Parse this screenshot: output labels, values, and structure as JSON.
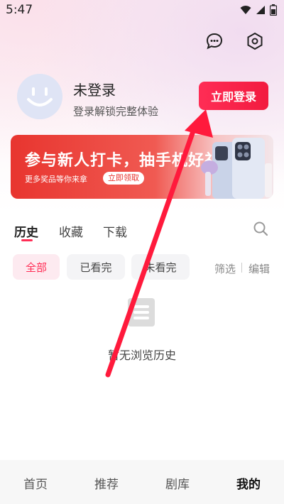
{
  "status_bar": {
    "time": "5:47"
  },
  "header": {
    "chat_icon": "chat-bubble-icon",
    "settings_icon": "hexagon-settings-icon"
  },
  "user": {
    "name": "未登录",
    "subtitle": "登录解锁完整体验",
    "login_label": "立即登录"
  },
  "banner": {
    "title": "参与新人打卡，抽手机好礼",
    "subtitle": "更多奖品等你来拿",
    "button_label": "立即领取"
  },
  "tabs": [
    {
      "label": "历史"
    },
    {
      "label": "收藏"
    },
    {
      "label": "下载"
    }
  ],
  "filters": {
    "chips": [
      {
        "label": "全部"
      },
      {
        "label": "已看完"
      },
      {
        "label": "未看完"
      }
    ],
    "filter_label": "筛选",
    "edit_label": "编辑"
  },
  "empty_state": {
    "text": "暂无浏览历史"
  },
  "bottom_nav": [
    {
      "label": "首页"
    },
    {
      "label": "推荐"
    },
    {
      "label": "剧库"
    },
    {
      "label": "我的"
    }
  ],
  "colors": {
    "accent": "#ff2d55",
    "banner_red": "#e8352f",
    "annotation_arrow": "#ff1a3c"
  }
}
